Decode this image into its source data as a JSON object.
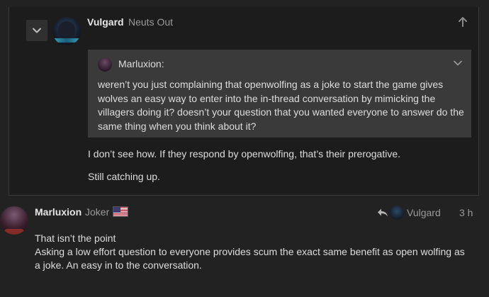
{
  "embedded_post": {
    "author": "Vulgard",
    "user_title": "Neuts Out",
    "quote": {
      "author": "Marluxion:",
      "text": "weren’t you just complaining that openwolfing as a joke to start the game gives wolves an easy way to enter into the in-thread conversation by mimicking the villagers doing it? doesn’t your question that you wanted everyone to answer do the same thing when you think about it?"
    },
    "paragraphs": [
      "I don’t see how. If they respond by openwolfing, that’s their prerogative.",
      "Still catching up."
    ]
  },
  "post": {
    "author": "Marluxion",
    "user_title": "Joker",
    "reply_to": "Vulgard",
    "time": "3 h",
    "body_line1": "That isn’t the point",
    "body_line2": "Asking a low effort question to everyone provides scum the exact same benefit as open wolfing as a joke. An easy in to the conversation."
  },
  "icons": {
    "collapse": "chevron-down-icon",
    "jump_up": "arrow-up-icon",
    "quote_toggle": "chevron-down-icon",
    "reply": "reply-arrow-icon",
    "flag": "us-flag-icon"
  },
  "colors": {
    "background": "#222222",
    "embed_background": "#1c1c1c",
    "quote_background": "#3a3a3a",
    "muted_text": "#9a9a9a"
  }
}
